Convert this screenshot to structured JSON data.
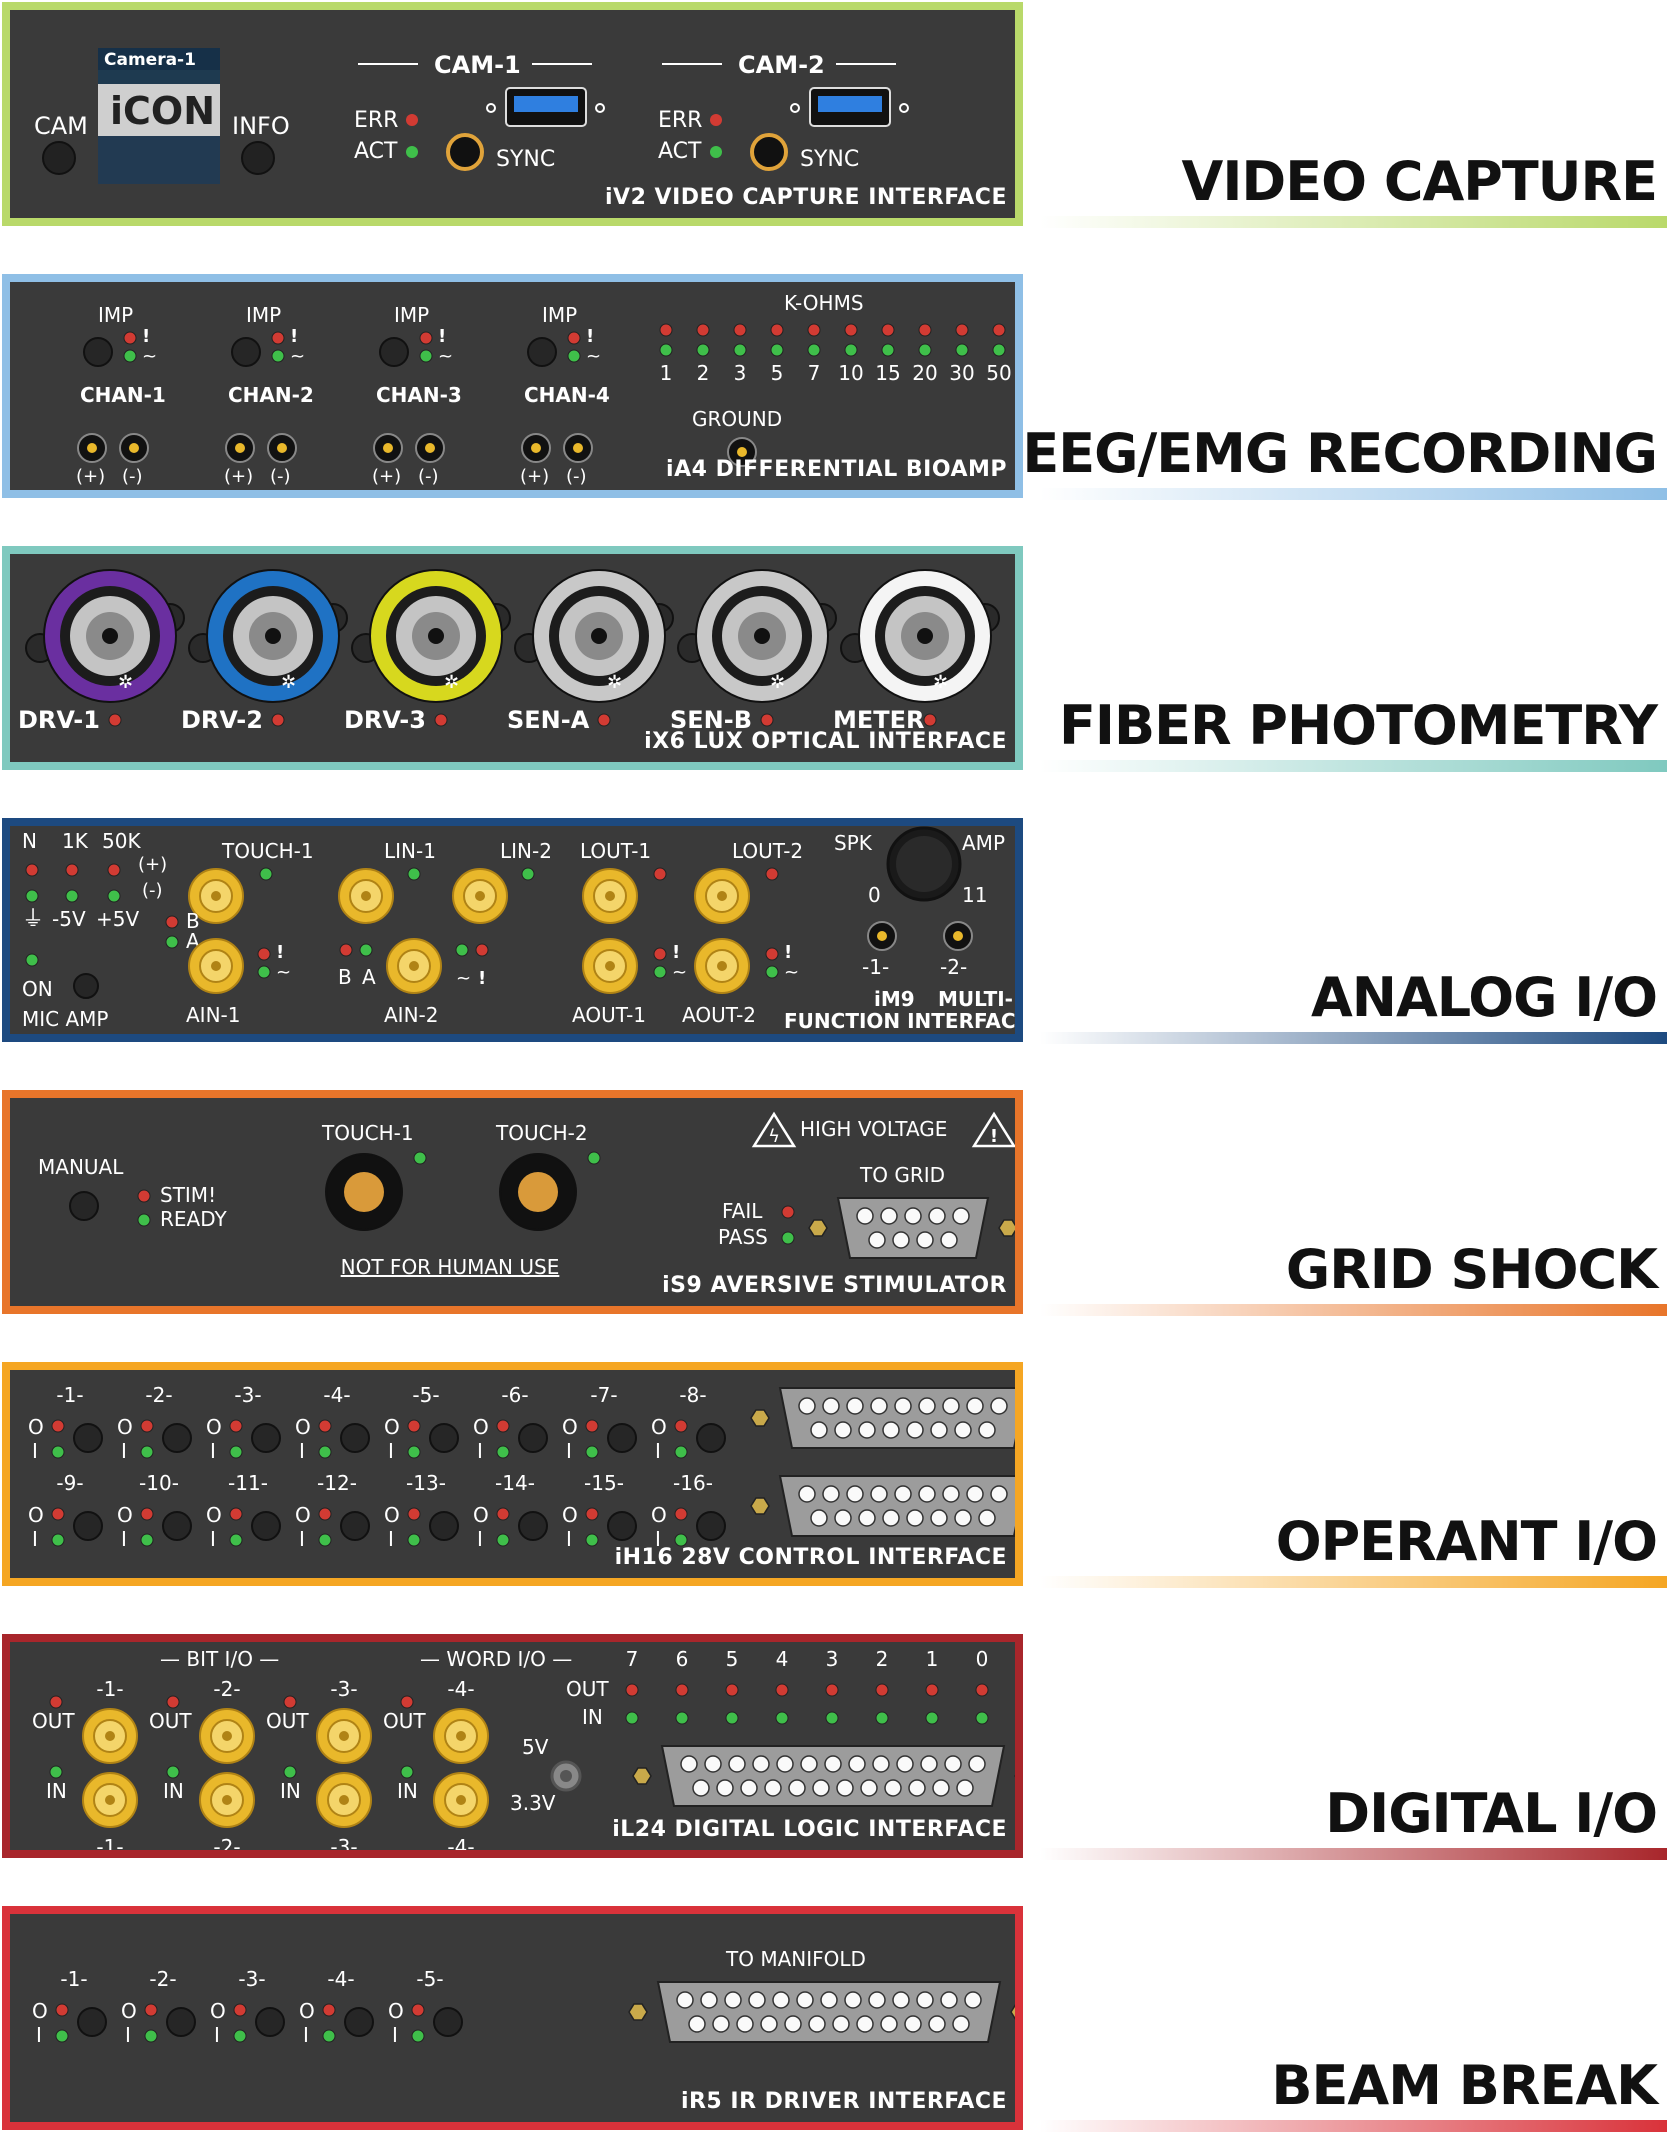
{
  "sections": [
    {
      "title": "VIDEO CAPTURE",
      "color": "#b9d96a"
    },
    {
      "title": "EEG/EMG RECORDING",
      "color": "#8fbfe6"
    },
    {
      "title": "FIBER PHOTOMETRY",
      "color": "#7fc9bf"
    },
    {
      "title": "ANALOG I/O",
      "color": "#1d4a80"
    },
    {
      "title": "GRID SHOCK",
      "color": "#e8752a"
    },
    {
      "title": "OPERANT I/O",
      "color": "#f5a623"
    },
    {
      "title": "DIGITAL I/O",
      "color": "#a8262b"
    },
    {
      "title": "BEAM BREAK",
      "color": "#d9323a"
    }
  ],
  "video": {
    "cam_btn": "CAM",
    "info_btn": "INFO",
    "screen_title": "Camera-1",
    "logo": "iCON",
    "cam1": "CAM-1",
    "cam2": "CAM-2",
    "err": "ERR",
    "act": "ACT",
    "sync": "SYNC",
    "tag": "iV2 VIDEO CAPTURE INTERFACE"
  },
  "eeg": {
    "imp": "IMP",
    "channels": [
      "CHAN-1",
      "CHAN-2",
      "CHAN-3",
      "CHAN-4"
    ],
    "plus": "(+)",
    "minus": "(-)",
    "kohms": "K-OHMS",
    "scale": [
      "1",
      "2",
      "3",
      "5",
      "7",
      "10",
      "15",
      "20",
      "30",
      "50"
    ],
    "ground": "GROUND",
    "tag": "iA4   DIFFERENTIAL BIOAMP"
  },
  "fiber": {
    "ports": [
      "DRV-1",
      "DRV-2",
      "DRV-3",
      "SEN-A",
      "SEN-B",
      "METER"
    ],
    "ring_colors": [
      "#6a2fa0",
      "#1f72c4",
      "#d7d81e",
      "#c8c8c8",
      "#c8c8c8",
      "#f4f4f4"
    ],
    "tag": "iX6 LUX OPTICAL INTERFACE"
  },
  "analog": {
    "n": "N",
    "k1": "1K",
    "k50": "50K",
    "plus": "(+)",
    "minus": "(-)",
    "m5": "-5V",
    "p5": "+5V",
    "on": "ON",
    "mic": "MIC AMP",
    "touch1": "TOUCH-1",
    "lin1": "LIN-1",
    "lin2": "LIN-2",
    "lout1": "LOUT-1",
    "lout2": "LOUT-2",
    "ain1": "AIN-1",
    "ain2": "AIN-2",
    "aout1": "AOUT-1",
    "aout2": "AOUT-2",
    "b": "B",
    "a": "A",
    "spk": "SPK",
    "amp": "AMP",
    "zero": "0",
    "eleven": "11",
    "one": "-1-",
    "two": "-2-",
    "im9": "iM9",
    "multi": "MULTI-",
    "fi": "FUNCTION INTERFACE"
  },
  "shock": {
    "manual": "MANUAL",
    "stim": "STIM!",
    "ready": "READY",
    "touch1": "TOUCH-1",
    "touch2": "TOUCH-2",
    "warn": "NOT FOR HUMAN USE",
    "hv": "HIGH VOLTAGE",
    "grid": "TO GRID",
    "fail": "FAIL",
    "pass": "PASS",
    "tag": "iS9    AVERSIVE STIMULATOR"
  },
  "operant": {
    "row1": [
      "-1-",
      "-2-",
      "-3-",
      "-4-",
      "-5-",
      "-6-",
      "-7-",
      "-8-"
    ],
    "row2": [
      "-9-",
      "-10-",
      "-11-",
      "-12-",
      "-13-",
      "-14-",
      "-15-",
      "-16-"
    ],
    "o": "O",
    "i": "I",
    "tag": "iH16    28V CONTROL INTERFACE"
  },
  "digital": {
    "bit": "— BIT I/O —",
    "word": "— WORD I/O —",
    "bits": [
      "-1-",
      "-2-",
      "-3-",
      "-4-"
    ],
    "out": "OUT",
    "in": "IN",
    "v5": "5V",
    "v33": "3.3V",
    "word_bits": [
      "7",
      "6",
      "5",
      "4",
      "3",
      "2",
      "1",
      "0"
    ],
    "tag": "iL24 DIGITAL LOGIC INTERFACE"
  },
  "beam": {
    "channels": [
      "-1-",
      "-2-",
      "-3-",
      "-4-",
      "-5-"
    ],
    "o": "O",
    "i": "I",
    "manifold": "TO MANIFOLD",
    "tag": "iR5    IR DRIVER INTERFACE"
  }
}
